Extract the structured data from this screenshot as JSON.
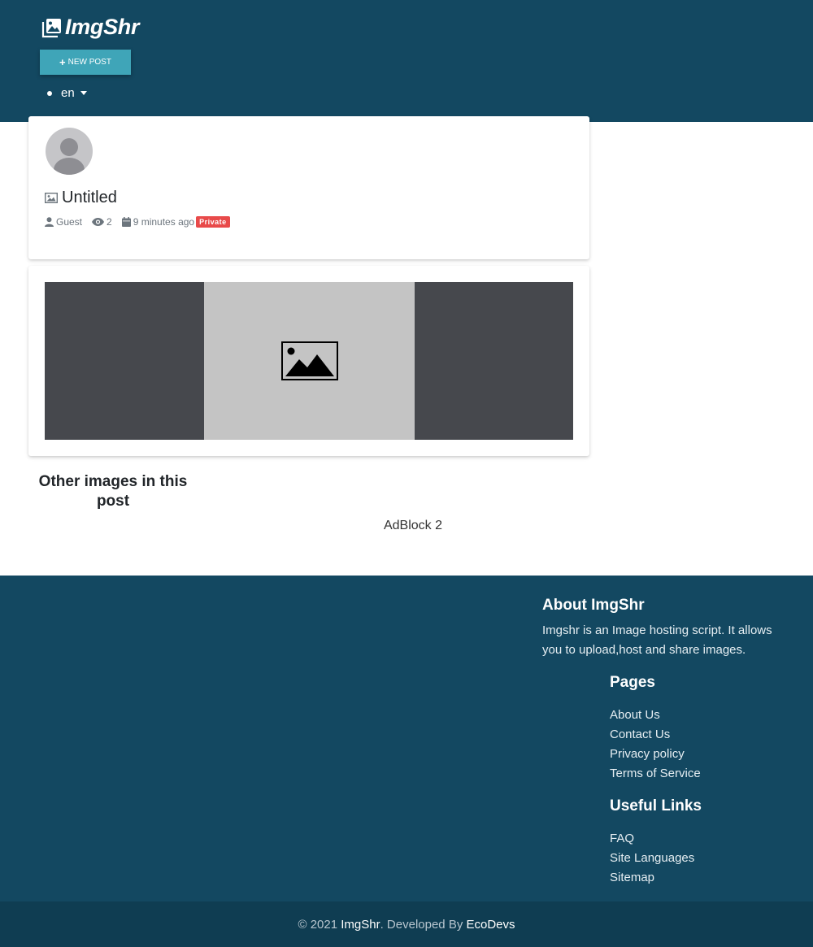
{
  "header": {
    "brand": "ImgShr",
    "new_post_label": "NEW POST",
    "language": "en"
  },
  "post": {
    "title": "Untitled",
    "author": "Guest",
    "views": "2",
    "time": "9 minutes ago",
    "visibility_badge": "Private"
  },
  "sections": {
    "other_images_title": "Other images in this post",
    "adblock_label": "AdBlock 2"
  },
  "footer": {
    "about_title": "About ImgShr",
    "about_text": "Imgshr is an Image hosting script. It allows you to upload,host and share images.",
    "pages_title": "Pages",
    "pages": [
      {
        "label": "About Us"
      },
      {
        "label": "Contact Us"
      },
      {
        "label": "Privacy policy"
      },
      {
        "label": "Terms of Service"
      }
    ],
    "useful_title": "Useful Links",
    "useful": [
      {
        "label": "FAQ"
      },
      {
        "label": "Site Languages"
      },
      {
        "label": "Sitemap"
      }
    ],
    "copyright_prefix": "© 2021",
    "copyright_brand": "ImgShr",
    "developed_by": ". Developed By",
    "developer": "EcoDevs"
  },
  "colors": {
    "header_bg": "#134861",
    "accent": "#3fa5b8",
    "badge": "#e84a4a"
  }
}
